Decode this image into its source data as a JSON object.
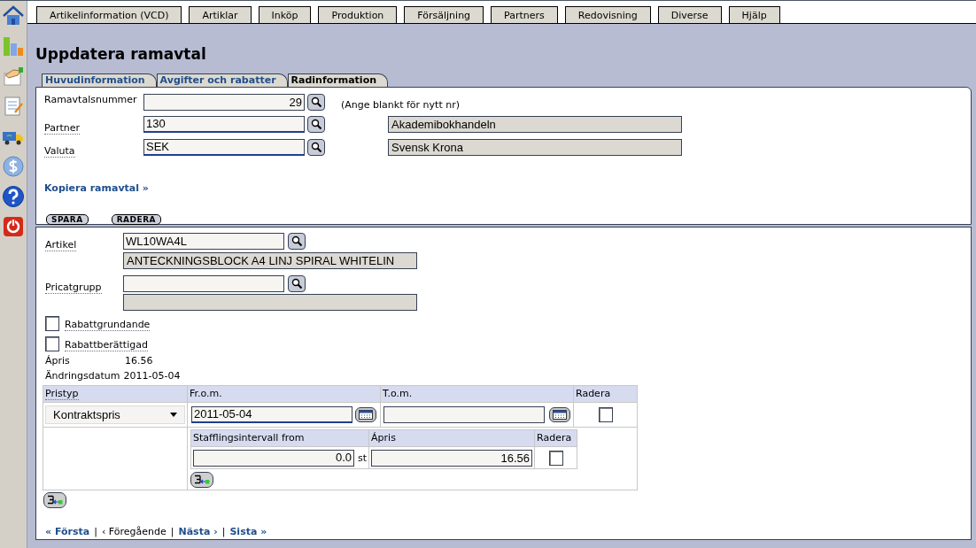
{
  "nav_tabs": [
    "Artikelinformation (VCD)",
    "Artiklar",
    "Inköp",
    "Produktion",
    "Försäljning",
    "Partners",
    "Redovisning",
    "Diverse",
    "Hjälp"
  ],
  "title": "Uppdatera ramavtal",
  "sub_tabs": [
    {
      "label": "Huvudinformation",
      "selected": false
    },
    {
      "label": "Avgifter och rabatter",
      "selected": false
    },
    {
      "label": "Radinformation",
      "selected": true
    }
  ],
  "header": {
    "number": {
      "label": "Ramavtalsnummer",
      "value": "29",
      "hint": "(Ange blankt för nytt nr)"
    },
    "partner": {
      "label": "Partner",
      "value": "130",
      "name": "Akademibokhandeln"
    },
    "currency": {
      "label": "Valuta",
      "value": "SEK",
      "name": "Svensk Krona"
    },
    "copy_link": "Kopiera ramavtal »",
    "buttons": [
      "SPARA",
      "RADERA"
    ]
  },
  "row": {
    "article": {
      "label": "Artikel",
      "value": "WL10WA4L",
      "description": "ANTECKNINGSBLOCK A4 LINJ SPIRAL WHITELIN"
    },
    "pricat": {
      "label": "Pricatgrupp"
    },
    "checkboxes": [
      {
        "label": "Rabattgrundande",
        "checked": false
      },
      {
        "label": "Rabattberättigad",
        "checked": false
      }
    ],
    "info": [
      {
        "label": "Ápris",
        "value": "16.56"
      },
      {
        "label": "Ändringsdatum",
        "value": "2011-05-04"
      }
    ],
    "price_table": {
      "columns": [
        "Pristyp",
        "Fr.o.m.",
        "T.o.m.",
        "Radera"
      ],
      "rows": [
        {
          "price_type": "Kontraktspris",
          "from": "2011-05-04",
          "delete_checked": false,
          "tiers": {
            "columns": [
              "Stafflingsintervall from",
              "Ápris",
              "Radera"
            ],
            "rows": [
              {
                "from": "0.0",
                "unit": "st",
                "price": "16.56",
                "delete_checked": false
              }
            ]
          }
        }
      ]
    }
  },
  "pager": [
    {
      "kind": "link",
      "label": "« Första",
      "disabled": false
    },
    {
      "kind": "separator",
      "label": "|"
    },
    {
      "kind": "link",
      "label": "‹ Föregående",
      "disabled": true
    },
    {
      "kind": "separator",
      "label": "|"
    },
    {
      "kind": "link",
      "label": "Nästa ›",
      "disabled": false
    },
    {
      "kind": "separator",
      "label": "|"
    },
    {
      "kind": "link",
      "label": "Sista »",
      "disabled": false
    }
  ]
}
